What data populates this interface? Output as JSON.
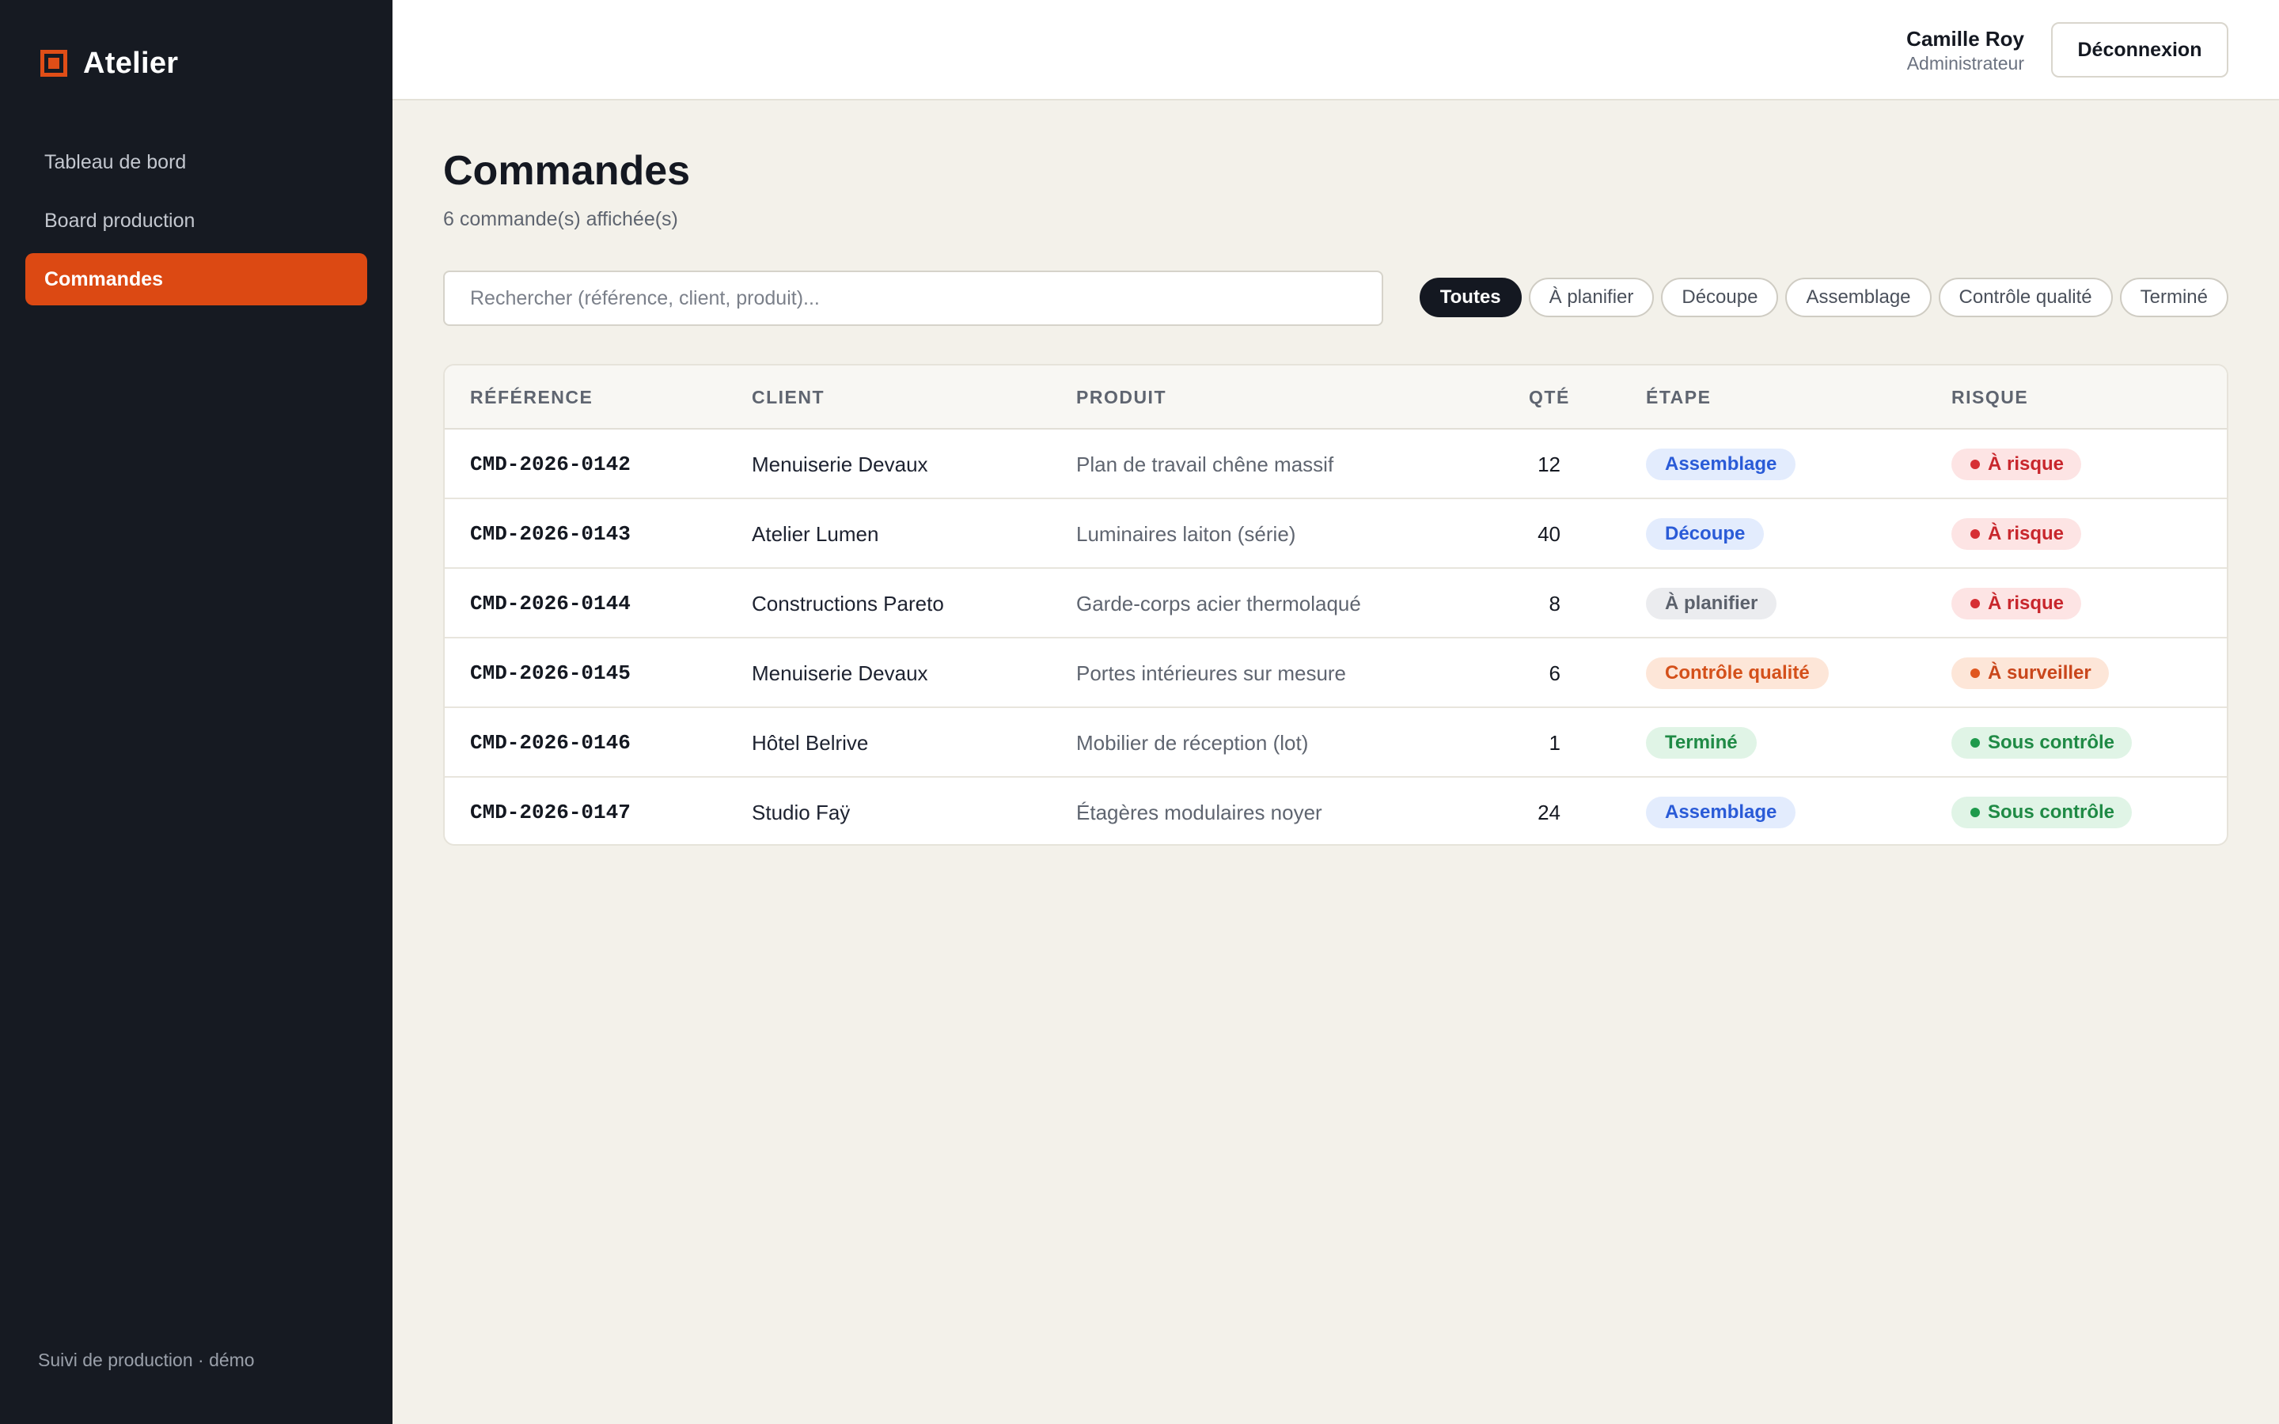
{
  "app": {
    "name": "Atelier",
    "footer": "Suivi de production · démo",
    "accent": "#dc4913"
  },
  "nav": {
    "items": [
      {
        "label": "Tableau de bord",
        "active": false
      },
      {
        "label": "Board production",
        "active": false
      },
      {
        "label": "Commandes",
        "active": true
      }
    ]
  },
  "user": {
    "name": "Camille Roy",
    "role": "Administrateur",
    "logout_label": "Déconnexion"
  },
  "page": {
    "title": "Commandes",
    "subtitle": "6 commande(s) affichée(s)"
  },
  "search": {
    "placeholder": "Rechercher (référence, client, produit)...",
    "value": ""
  },
  "filters": [
    {
      "label": "Toutes",
      "active": true
    },
    {
      "label": "À planifier",
      "active": false
    },
    {
      "label": "Découpe",
      "active": false
    },
    {
      "label": "Assemblage",
      "active": false
    },
    {
      "label": "Contrôle qualité",
      "active": false
    },
    {
      "label": "Terminé",
      "active": false
    }
  ],
  "table": {
    "columns": [
      "RÉFÉRENCE",
      "CLIENT",
      "PRODUIT",
      "QTÉ",
      "ÉTAPE",
      "RISQUE"
    ],
    "rows": [
      {
        "ref": "CMD-2026-0142",
        "client": "Menuiserie Devaux",
        "product": "Plan de travail chêne massif",
        "qty": "12",
        "stage": "Assemblage",
        "stage_bg": "#e3ecfd",
        "stage_color": "#2a5bd7",
        "risk": "À risque",
        "risk_bg": "#fde4e4",
        "risk_color": "#c8262c",
        "risk_dot": "#d62f34"
      },
      {
        "ref": "CMD-2026-0143",
        "client": "Atelier Lumen",
        "product": "Luminaires laiton (série)",
        "qty": "40",
        "stage": "Découpe",
        "stage_bg": "#e3ecfd",
        "stage_color": "#2a5bd7",
        "risk": "À risque",
        "risk_bg": "#fde4e4",
        "risk_color": "#c8262c",
        "risk_dot": "#d62f34"
      },
      {
        "ref": "CMD-2026-0144",
        "client": "Constructions Pareto",
        "product": "Garde-corps acier thermolaqué",
        "qty": "8",
        "stage": "À planifier",
        "stage_bg": "#ebecef",
        "stage_color": "#5b616c",
        "risk": "À risque",
        "risk_bg": "#fde4e4",
        "risk_color": "#c8262c",
        "risk_dot": "#d62f34"
      },
      {
        "ref": "CMD-2026-0145",
        "client": "Menuiserie Devaux",
        "product": "Portes intérieures sur mesure",
        "qty": "6",
        "stage": "Contrôle qualité",
        "stage_bg": "#fde6d8",
        "stage_color": "#d4501a",
        "risk": "À surveiller",
        "risk_bg": "#fde6d8",
        "risk_color": "#c9461b",
        "risk_dot": "#e0571f"
      },
      {
        "ref": "CMD-2026-0146",
        "client": "Hôtel Belrive",
        "product": "Mobilier de réception (lot)",
        "qty": "1",
        "stage": "Terminé",
        "stage_bg": "#e0f4e6",
        "stage_color": "#1f8a45",
        "risk": "Sous contrôle",
        "risk_bg": "#e0f4e6",
        "risk_color": "#1f8a45",
        "risk_dot": "#1f9a4c"
      },
      {
        "ref": "CMD-2026-0147",
        "client": "Studio Faÿ",
        "product": "Étagères modulaires noyer",
        "qty": "24",
        "stage": "Assemblage",
        "stage_bg": "#e3ecfd",
        "stage_color": "#2a5bd7",
        "risk": "Sous contrôle",
        "risk_bg": "#e0f4e6",
        "risk_color": "#1f8a45",
        "risk_dot": "#1f9a4c"
      }
    ]
  }
}
